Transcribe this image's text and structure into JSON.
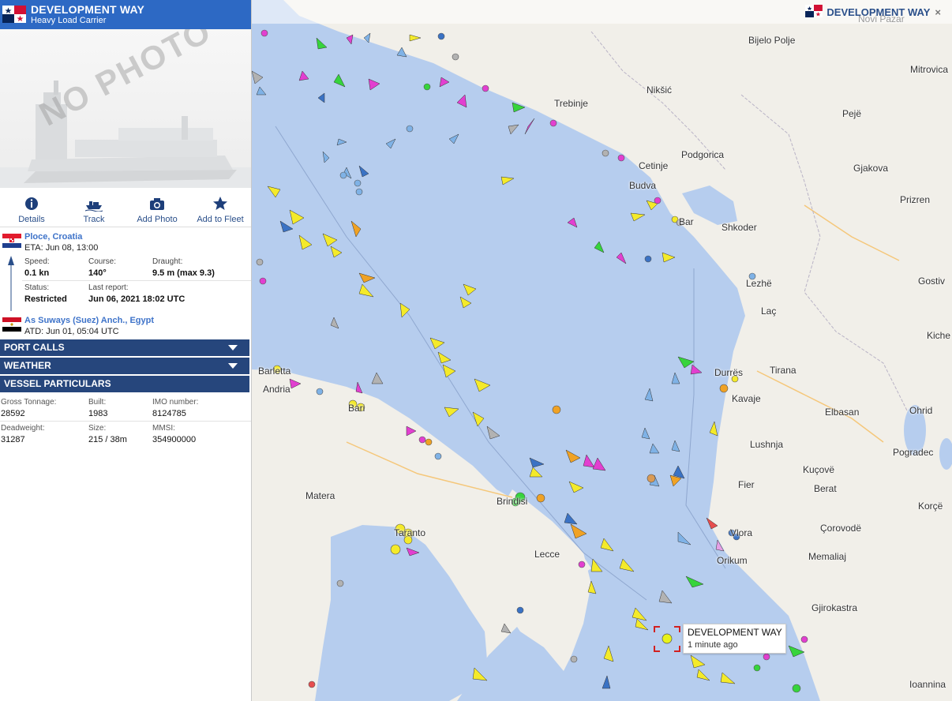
{
  "vessel": {
    "name": "DEVELOPMENT WAY",
    "type": "Heavy Load Carrier",
    "photo_text": "NO PHOTO"
  },
  "actions": [
    {
      "label": "Details",
      "icon": "info-icon"
    },
    {
      "label": "Track",
      "icon": "ship-track-icon"
    },
    {
      "label": "Add Photo",
      "icon": "camera-icon"
    },
    {
      "label": "Add to Fleet",
      "icon": "star-icon"
    }
  ],
  "destination": {
    "port": "Ploce, Croatia",
    "time": "ETA: Jun 08, 13:00",
    "flag": "croatia"
  },
  "origin": {
    "port": "As Suways (Suez) Anch., Egypt",
    "time": "ATD: Jun 01, 05:04 UTC",
    "flag": "egypt"
  },
  "status": {
    "speed_label": "Speed:",
    "speed": "0.1 kn",
    "course_label": "Course:",
    "course": "140°",
    "draught_label": "Draught:",
    "draught": "9.5 m (max 9.3)",
    "status_label": "Status:",
    "status": "Restricted",
    "last_report_label": "Last report:",
    "last_report": "Jun 06, 2021 18:02 UTC"
  },
  "sections": {
    "port_calls": "PORT CALLS",
    "weather": "WEATHER",
    "particulars": "VESSEL PARTICULARS"
  },
  "particulars": {
    "gross_label": "Gross Tonnage:",
    "gross": "28592",
    "built_label": "Built:",
    "built": "1983",
    "imo_label": "IMO number:",
    "imo": "8124785",
    "deadweight_label": "Deadweight:",
    "deadweight": "31287",
    "size_label": "Size:",
    "size": "215 / 38m",
    "mmsi_label": "MMSI:",
    "mmsi": "354900000"
  },
  "map": {
    "tab_title": "DEVELOPMENT WAY",
    "close": "×",
    "callout_name": "DEVELOPMENT WAY",
    "callout_time": "1 minute ago",
    "places": {
      "novi_pazar": "Novi Pazar",
      "bijelo_polje": "Bijelo Polje",
      "mitrovica": "Mitrovica",
      "niksic": "Nikšić",
      "trebinje": "Trebinje",
      "peje": "Pejë",
      "podgorica": "Podgorica",
      "gjakova": "Gjakova",
      "cetinje": "Cetinje",
      "budva": "Budva",
      "prizren": "Prizren",
      "bar": "Bar",
      "shkoder": "Shkoder",
      "lezhe": "Lezhë",
      "gostiv": "Gostiv",
      "lac": "Laç",
      "kiche": "Kiche",
      "durres": "Durrës",
      "tirana": "Tirana",
      "barletta": "Barletta",
      "andria": "Andria",
      "kavaje": "Kavaje",
      "bari": "Bari",
      "elbasan": "Elbasan",
      "ohrid": "Ohrid",
      "lushnja": "Lushnja",
      "pogradec": "Pogradec",
      "kucove": "Kuçovë",
      "fier": "Fier",
      "matera": "Matera",
      "brindisi": "Brindisi",
      "berat": "Berat",
      "korce": "Korçë",
      "corovode": "Çorovodë",
      "vlora": "Vlora",
      "taranto": "Taranto",
      "lecce": "Lecce",
      "orikum": "Orikum",
      "memaliaj": "Memaliaj",
      "gjirokastra": "Gjirokastra",
      "ioannina": "Ioannina"
    }
  },
  "colors": {
    "header_blue": "#2d69c4",
    "section_navy": "#26467c",
    "link_blue": "#3e73c9",
    "sea": "#b6cdee",
    "land": "#f1efe9",
    "ship_yellow": "#f4ea2a",
    "ship_blue": "#7fb2e6",
    "ship_green": "#36d43c",
    "ship_magenta": "#e23fd0",
    "ship_gray": "#b2b2b2",
    "ship_orange": "#f0a224",
    "callout_bracket": "#d22020"
  }
}
